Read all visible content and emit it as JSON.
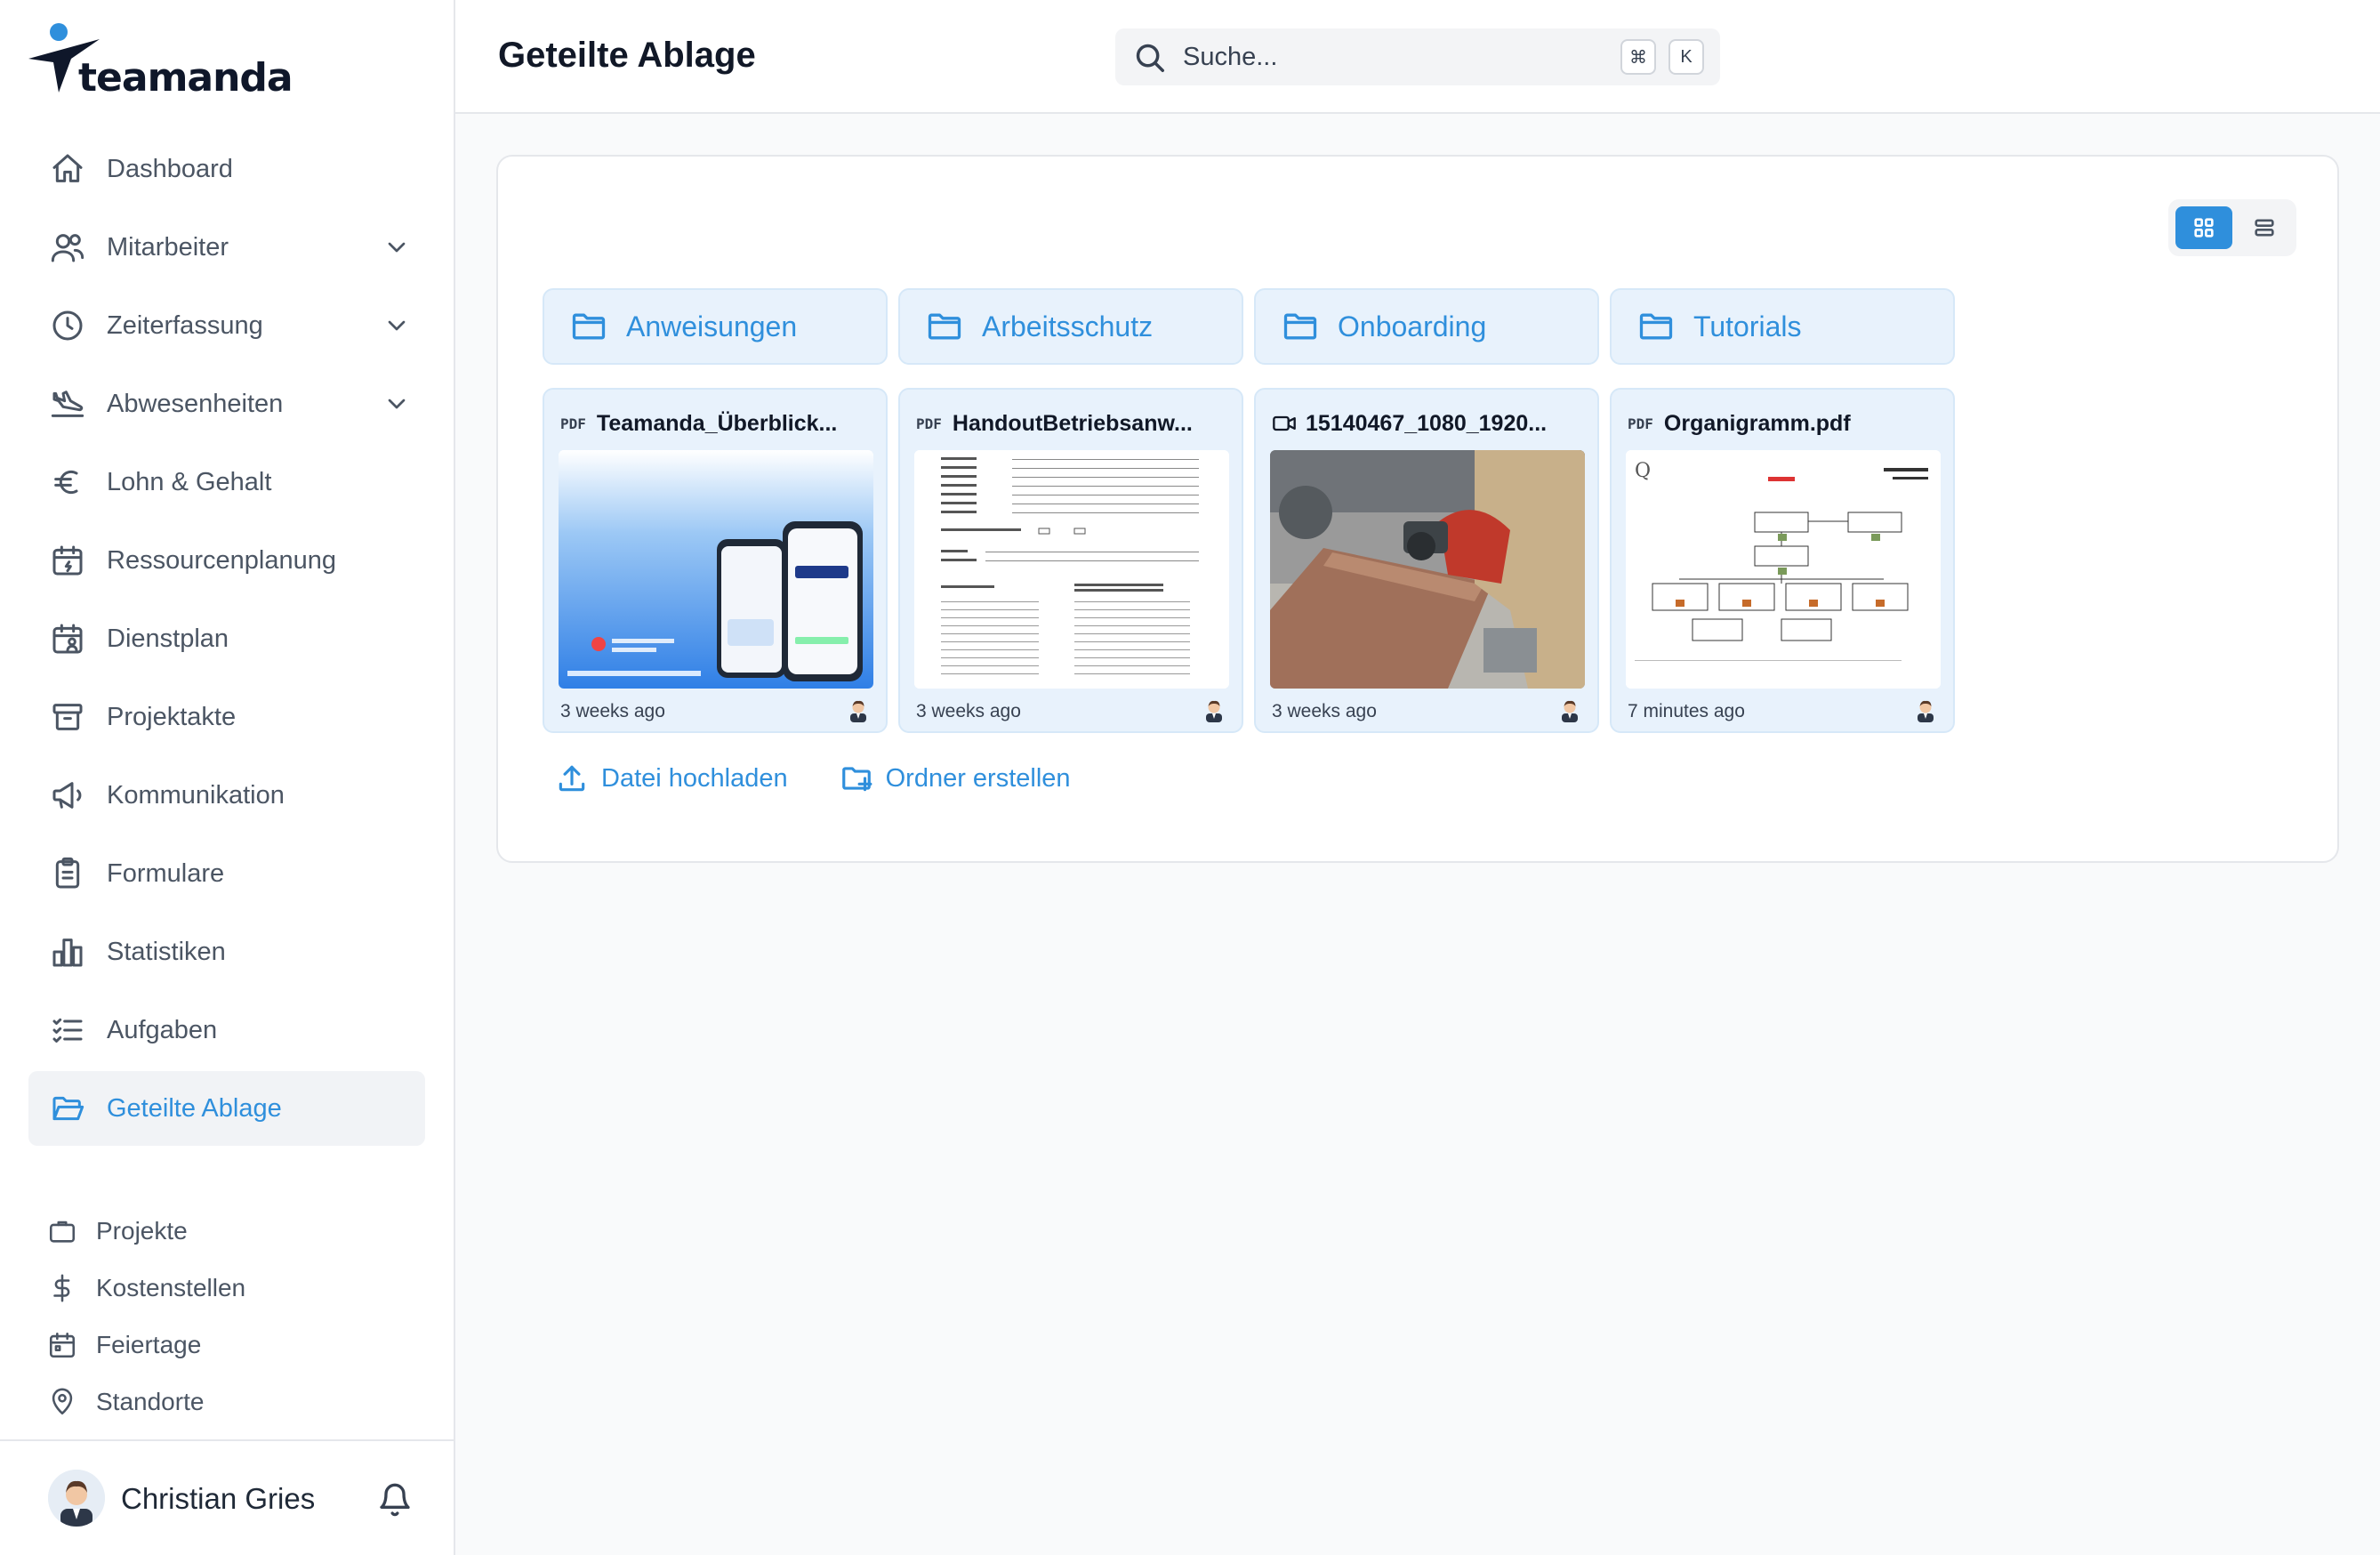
{
  "app": {
    "logo_text": "teamanda"
  },
  "sidebar": {
    "items": [
      {
        "label": "Dashboard",
        "icon": "home-icon",
        "expandable": false,
        "active": false
      },
      {
        "label": "Mitarbeiter",
        "icon": "users-icon",
        "expandable": true,
        "active": false
      },
      {
        "label": "Zeiterfassung",
        "icon": "clock-icon",
        "expandable": true,
        "active": false
      },
      {
        "label": "Abwesenheiten",
        "icon": "plane-icon",
        "expandable": true,
        "active": false
      },
      {
        "label": "Lohn & Gehalt",
        "icon": "euro-icon",
        "expandable": false,
        "active": false
      },
      {
        "label": "Ressourcenplanung",
        "icon": "calendar-bolt-icon",
        "expandable": false,
        "active": false
      },
      {
        "label": "Dienstplan",
        "icon": "calendar-user-icon",
        "expandable": false,
        "active": false
      },
      {
        "label": "Projektakte",
        "icon": "archive-icon",
        "expandable": false,
        "active": false
      },
      {
        "label": "Kommunikation",
        "icon": "megaphone-icon",
        "expandable": false,
        "active": false
      },
      {
        "label": "Formulare",
        "icon": "clipboard-icon",
        "expandable": false,
        "active": false
      },
      {
        "label": "Statistiken",
        "icon": "bar-chart-icon",
        "expandable": false,
        "active": false
      },
      {
        "label": "Aufgaben",
        "icon": "task-list-icon",
        "expandable": false,
        "active": false
      },
      {
        "label": "Geteilte Ablage",
        "icon": "folder-open-icon",
        "expandable": false,
        "active": true
      }
    ],
    "secondary": [
      {
        "label": "Projekte",
        "icon": "briefcase-icon"
      },
      {
        "label": "Kostenstellen",
        "icon": "dollar-icon"
      },
      {
        "label": "Feiertage",
        "icon": "calendar-icon"
      },
      {
        "label": "Standorte",
        "icon": "map-pin-icon"
      }
    ],
    "user": {
      "name": "Christian Gries"
    }
  },
  "header": {
    "title": "Geteilte Ablage",
    "search_placeholder": "Suche...",
    "shortcut_keys": [
      "⌘",
      "K"
    ]
  },
  "folders": [
    {
      "name": "Anweisungen"
    },
    {
      "name": "Arbeitsschutz"
    },
    {
      "name": "Onboarding"
    },
    {
      "name": "Tutorials"
    }
  ],
  "files": [
    {
      "name": "Teamanda_Überblick...",
      "type": "PDF",
      "time": "3 weeks ago",
      "thumb": "brochure"
    },
    {
      "name": "HandoutBetriebsanw...",
      "type": "PDF",
      "time": "3 weeks ago",
      "thumb": "form"
    },
    {
      "name": "15140467_1080_1920...",
      "type": "VIDEO",
      "time": "3 weeks ago",
      "thumb": "photo"
    },
    {
      "name": "Organigramm.pdf",
      "type": "PDF",
      "time": "7 minutes ago",
      "thumb": "orgchart"
    }
  ],
  "actions": {
    "upload": "Datei hochladen",
    "create_folder": "Ordner erstellen"
  },
  "colors": {
    "accent": "#2f8fdc",
    "tile_bg": "#e8f2fc"
  }
}
